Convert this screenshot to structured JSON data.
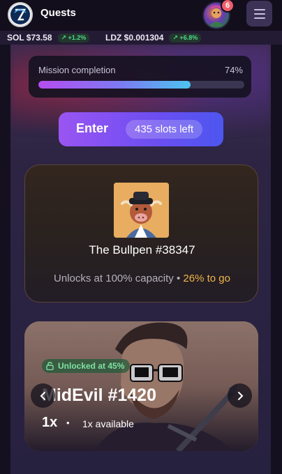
{
  "header": {
    "title": "Quests",
    "logo_icon": "app-logo",
    "notification_count": "6",
    "menu_icon": "hamburger-icon"
  },
  "ticker": [
    {
      "label": "SOL $73.58",
      "change": "↗ +1.2%"
    },
    {
      "label": "LDZ $0.001304",
      "change": "↗ +6.8%"
    }
  ],
  "mission": {
    "label": "Mission completion",
    "percent_text": "74%",
    "progress": 0.74
  },
  "enter_button": {
    "label": "Enter",
    "slots": "435 slots left"
  },
  "bullpen": {
    "name": "The Bullpen #38347",
    "unlock_text": "Unlocks at 100% capacity",
    "separator": "•",
    "to_go": "26% to go"
  },
  "midevil": {
    "status": "Unlocked at 45%",
    "name": "MidEvil #1420",
    "quantity": "1x",
    "separator": "•",
    "available": "1x available"
  },
  "colors": {
    "accent_purple": "#9a55f2",
    "accent_blue": "#4d56f0",
    "to_go_orange": "#f0b548",
    "unlocked_green": "#7fe2a0",
    "badge_red": "#ef5f6a",
    "ticker_green": "#4fd88a"
  }
}
